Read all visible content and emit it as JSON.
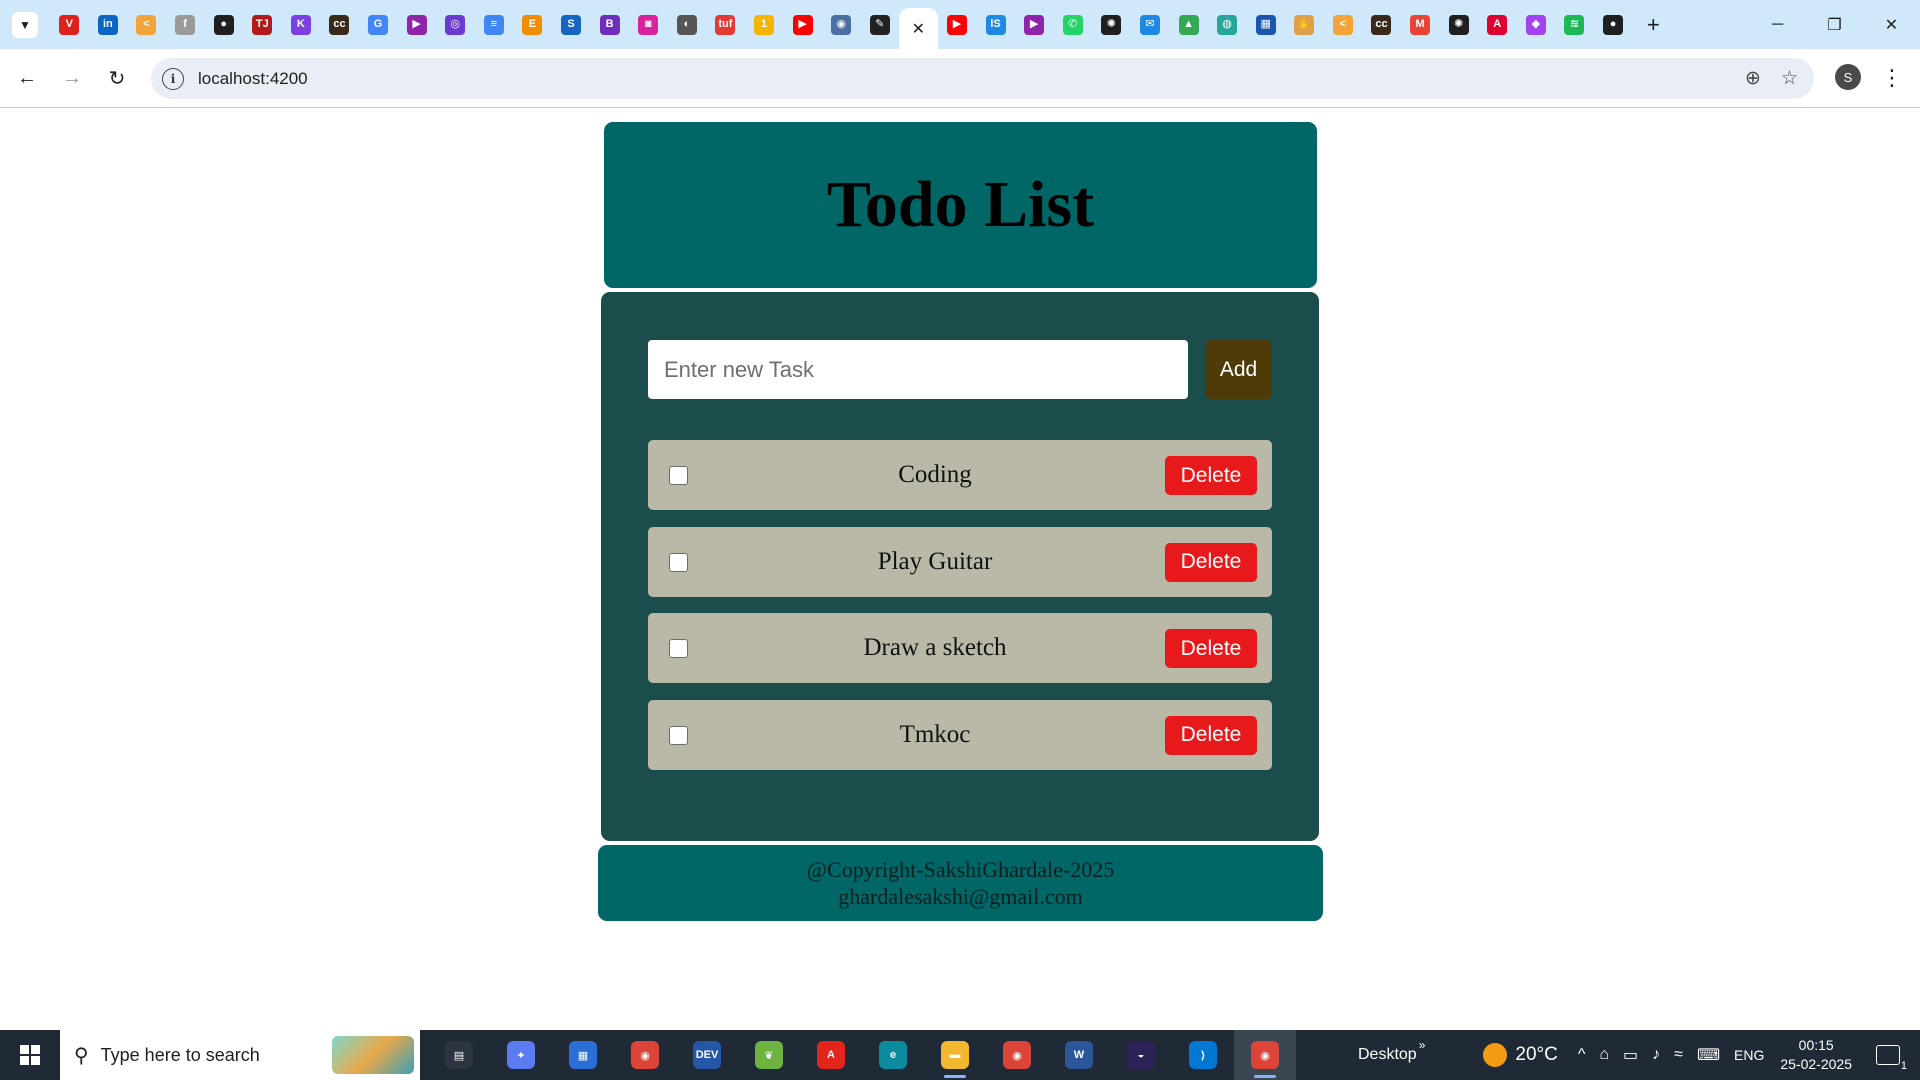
{
  "browser": {
    "tab_list_icon": "chevron-down-icon",
    "pinned_tabs": [
      {
        "icon": "vivaldi-v-icon",
        "color": "#e0201c",
        "glyph": "V"
      },
      {
        "icon": "linkedin-icon",
        "color": "#0a66c2",
        "glyph": "in"
      },
      {
        "icon": "codehelp-icon",
        "color": "#f2a33a",
        "glyph": "<"
      },
      {
        "icon": "small-f-icon",
        "color": "#9a9a9a",
        "glyph": "f"
      },
      {
        "icon": "github-icon",
        "color": "#1f1f1f",
        "glyph": "●"
      },
      {
        "icon": "tj-icon",
        "color": "#b31b1b",
        "glyph": "TJ"
      },
      {
        "icon": "kodekloud-icon",
        "color": "#7b3fe4",
        "glyph": "K"
      },
      {
        "icon": "cc-icon",
        "color": "#3b2a1a",
        "glyph": "cc"
      },
      {
        "icon": "google-icon",
        "color": "#4285f4",
        "glyph": "G"
      },
      {
        "icon": "play-arrow-icon",
        "color": "#8e24aa",
        "glyph": "▶"
      },
      {
        "icon": "circle-purple-icon",
        "color": "#6a3bd3",
        "glyph": "◎"
      },
      {
        "icon": "docs-icon",
        "color": "#4285f4",
        "glyph": "≡"
      },
      {
        "icon": "e-icon",
        "color": "#f08c00",
        "glyph": "E"
      },
      {
        "icon": "s-icon",
        "color": "#1565c0",
        "glyph": "S"
      },
      {
        "icon": "b-icon",
        "color": "#6f2dbd",
        "glyph": "B"
      },
      {
        "icon": "instagram-icon",
        "color": "#d6249f",
        "glyph": "◙"
      },
      {
        "icon": "globe-icon",
        "color": "#555555",
        "glyph": "◐"
      },
      {
        "icon": "tuf-icon",
        "color": "#e53935",
        "glyph": "tuf"
      },
      {
        "icon": "one-icon",
        "color": "#f5b400",
        "glyph": "1"
      },
      {
        "icon": "youtube-icon",
        "color": "#ff0000",
        "glyph": "▶"
      },
      {
        "icon": "compass-icon",
        "color": "#4a6fa5",
        "glyph": "◉"
      },
      {
        "icon": "pencil-icon",
        "color": "#222222",
        "glyph": "✎"
      }
    ],
    "active_tab_close_icon": "close-icon",
    "more_tabs": [
      {
        "icon": "youtube-icon",
        "color": "#ff0000",
        "glyph": "▶"
      },
      {
        "icon": "ls-icon",
        "color": "#1e88e5",
        "glyph": "lS"
      },
      {
        "icon": "play-arrow-icon",
        "color": "#8e24aa",
        "glyph": "▶"
      },
      {
        "icon": "whatsapp-icon",
        "color": "#25d366",
        "glyph": "✆"
      },
      {
        "icon": "openai-icon",
        "color": "#1f1f1f",
        "glyph": "✺"
      },
      {
        "icon": "chat-icon",
        "color": "#1e88e5",
        "glyph": "✉"
      },
      {
        "icon": "drive-icon",
        "color": "#34a853",
        "glyph": "▲"
      },
      {
        "icon": "globe-teal-icon",
        "color": "#26a69a",
        "glyph": "◍"
      },
      {
        "icon": "layout-icon",
        "color": "#1a56b0",
        "glyph": "▦"
      },
      {
        "icon": "hand-icon",
        "color": "#e0a04a",
        "glyph": "✋"
      },
      {
        "icon": "codehelp-icon",
        "color": "#f2a33a",
        "glyph": "<"
      },
      {
        "icon": "cc-icon",
        "color": "#3b2a1a",
        "glyph": "cc"
      },
      {
        "icon": "gmail-icon",
        "color": "#ea4335",
        "glyph": "M"
      },
      {
        "icon": "openai-icon",
        "color": "#1f1f1f",
        "glyph": "✺"
      },
      {
        "icon": "angular-icon",
        "color": "#dd0031",
        "glyph": "A"
      },
      {
        "icon": "gradient-icon",
        "color": "#a442f0",
        "glyph": "◆"
      },
      {
        "icon": "spotify-icon",
        "color": "#1db954",
        "glyph": "≋"
      },
      {
        "icon": "github-icon",
        "color": "#1f1f1f",
        "glyph": "●"
      }
    ],
    "new_tab_glyph": "+",
    "window_controls": {
      "minimize": "─",
      "restore": "❐",
      "close": "✕"
    },
    "back_glyph": "←",
    "forward_glyph": "→",
    "reload_glyph": "↻",
    "site_info_glyph": "i",
    "url": "localhost:4200",
    "zoom_glyph": "⊕",
    "bookmark_glyph": "☆",
    "profile_initial": "S",
    "menu_glyph": "⋮"
  },
  "app": {
    "title": "Todo List",
    "input_placeholder": "Enter new Task",
    "input_value": "",
    "add_label": "Add",
    "tasks": [
      {
        "text": "Coding",
        "done": false,
        "delete_label": "Delete"
      },
      {
        "text": "Play Guitar",
        "done": false,
        "delete_label": "Delete"
      },
      {
        "text": "Draw a sketch",
        "done": false,
        "delete_label": "Delete"
      },
      {
        "text": "Tmkoc",
        "done": false,
        "delete_label": "Delete"
      }
    ],
    "footer": {
      "copyright": "@Copyright-SakshiGhardale-2025",
      "email": "ghardalesakshi@gmail.com"
    },
    "colors": {
      "header_bg": "#006666",
      "panel_bg": "#1b4d4c",
      "task_bg": "#bab9a8",
      "add_button": "#4e3b08",
      "delete_button": "#e8191b"
    }
  },
  "taskbar": {
    "search_placeholder": "Type here to search",
    "apps": [
      {
        "icon": "task-view-icon",
        "color": "#2b3440",
        "glyph": "▤",
        "running": false
      },
      {
        "icon": "copilot-icon",
        "color": "#5b7cf0",
        "glyph": "✦",
        "running": false
      },
      {
        "icon": "microsoft-store-icon",
        "color": "#2b6fd6",
        "glyph": "▦",
        "running": false
      },
      {
        "icon": "chrome-icon",
        "color": "#db4437",
        "glyph": "◉",
        "running": false
      },
      {
        "icon": "devcpp-icon",
        "color": "#2457a6",
        "glyph": "DEV",
        "running": false
      },
      {
        "icon": "spring-icon",
        "color": "#6db33f",
        "glyph": "❦",
        "running": false
      },
      {
        "icon": "acrobat-icon",
        "color": "#e1251b",
        "glyph": "A",
        "running": false
      },
      {
        "icon": "edge-icon",
        "color": "#0c8a9e",
        "glyph": "e",
        "running": false
      },
      {
        "icon": "file-explorer-icon",
        "color": "#f3b730",
        "glyph": "▬",
        "running": true
      },
      {
        "icon": "chrome-profile-icon",
        "color": "#db4437",
        "glyph": "◉",
        "running": false
      },
      {
        "icon": "word-icon",
        "color": "#2b579a",
        "glyph": "W",
        "running": false
      },
      {
        "icon": "eclipse-icon",
        "color": "#2c2255",
        "glyph": "◒",
        "running": false
      },
      {
        "icon": "vscode-icon",
        "color": "#0078d4",
        "glyph": "⟩",
        "running": false
      },
      {
        "icon": "chrome-active-icon",
        "color": "#db4437",
        "glyph": "◉",
        "running": true
      }
    ],
    "desktop_label": "Desktop",
    "desktop_chevron": "»",
    "temperature": "20°C",
    "tray_icons": [
      "^",
      "⌂",
      "▭",
      "♪",
      "≈",
      "⌨"
    ],
    "language": "ENG",
    "time": "00:15",
    "date": "25-02-2025",
    "notification_count": "1"
  }
}
